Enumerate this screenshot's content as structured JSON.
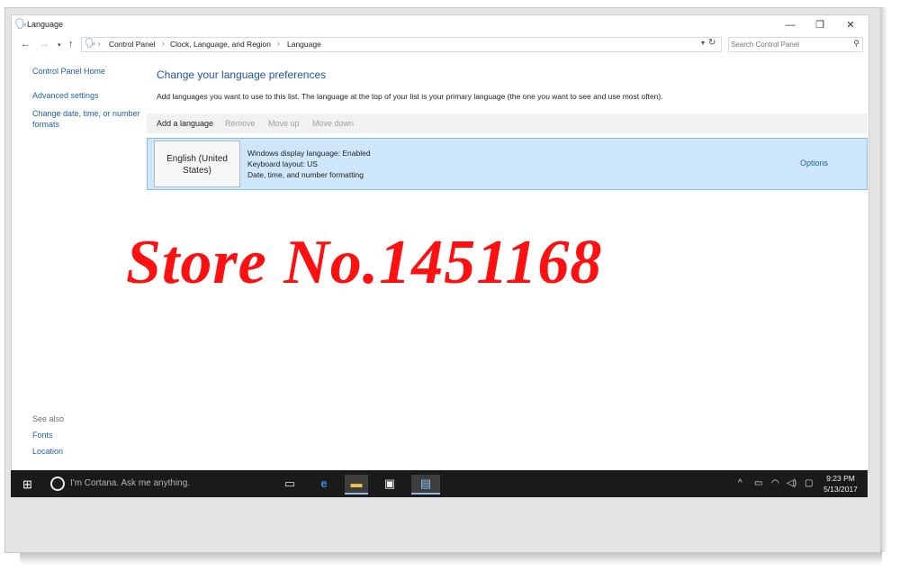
{
  "window": {
    "title": "Language",
    "controls": {
      "minimize": "—",
      "maximize": "❐",
      "close": "✕"
    }
  },
  "address": {
    "breadcrumbs": [
      "Control Panel",
      "Clock, Language, and Region",
      "Language"
    ],
    "search_placeholder": "Search Control Panel"
  },
  "sidebar": {
    "links": [
      "Control Panel Home",
      "Advanced settings",
      "Change date, time, or number formats"
    ],
    "see_also_label": "See also",
    "see_also_links": [
      "Fonts",
      "Location"
    ]
  },
  "main": {
    "title": "Change your language preferences",
    "description": "Add languages you want to use to this list. The language at the top of your list is your primary language (the one you want to see and use most often).",
    "toolbar": {
      "add": "Add a language",
      "remove": "Remove",
      "move_up": "Move up",
      "move_down": "Move down"
    },
    "languages": [
      {
        "name": "English (United States)",
        "details": [
          "Windows display language: Enabled",
          "Keyboard layout: US",
          "Date, time, and number formatting"
        ],
        "options": "Options"
      }
    ]
  },
  "watermark": "Store No.1451168",
  "taskbar": {
    "cortana_placeholder": "I'm Cortana. Ask me anything.",
    "clock_time": "9:23 PM",
    "clock_date": "5/13/2017"
  },
  "colors": {
    "link": "#1f5fa8",
    "title": "#1e56a8",
    "selection": "#cfe7fb",
    "watermark": "#ff1010",
    "taskbar": "#1a1a1a"
  }
}
